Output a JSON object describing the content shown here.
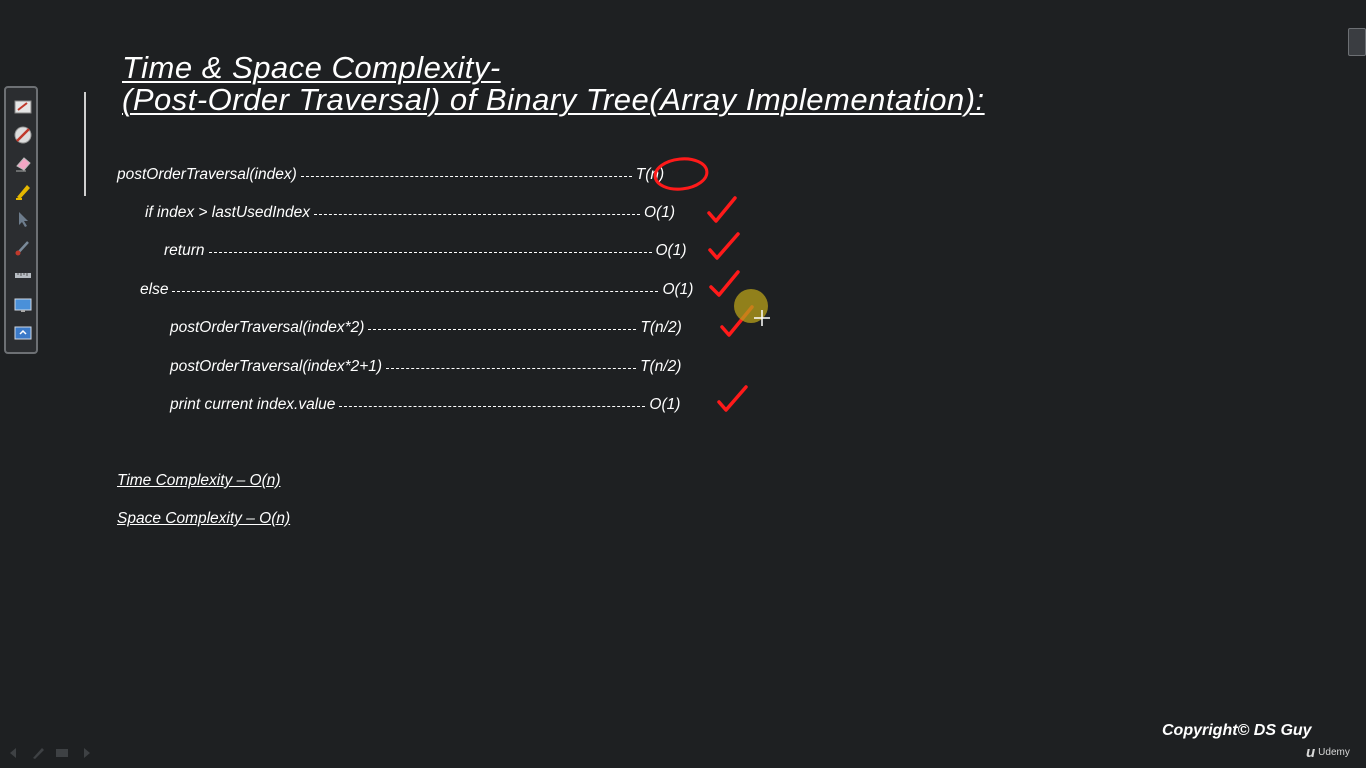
{
  "title": {
    "line1": "Time & Space Complexity-",
    "line2": "(Post-Order Traversal) of Binary Tree(Array Implementation):"
  },
  "code_lines": [
    {
      "code": "postOrderTraversal(index)",
      "cost": "T(n)",
      "mark": "circle"
    },
    {
      "code": "if index > lastUsedIndex",
      "cost": "O(1)",
      "mark": "check"
    },
    {
      "code": "return",
      "cost": "O(1)",
      "mark": "check"
    },
    {
      "code": "else",
      "cost": "O(1)",
      "mark": "check"
    },
    {
      "code": "postOrderTraversal(index*2)",
      "cost": "T(n/2)",
      "mark": "check"
    },
    {
      "code": "postOrderTraversal(index*2+1)",
      "cost": "T(n/2)",
      "mark": "none"
    },
    {
      "code": "print current index.value",
      "cost": "O(1)",
      "mark": "check"
    }
  ],
  "summary": {
    "time": "Time Complexity – O(n)",
    "space": "Space Complexity – O(n)"
  },
  "footer": {
    "copyright": "Copyright© DS Guy",
    "brand": "Udemy"
  },
  "toolbar": {
    "tools": [
      "whiteboard-icon",
      "pen-disabled-icon",
      "eraser-icon",
      "highlighter-icon",
      "pointer-icon",
      "brush-icon",
      "ruler-icon",
      "screen-capture-icon",
      "screen-share-icon"
    ]
  },
  "annotation_color": "#ff1a1a",
  "cursor_color": "#b8a01a",
  "background": "#1e2022"
}
